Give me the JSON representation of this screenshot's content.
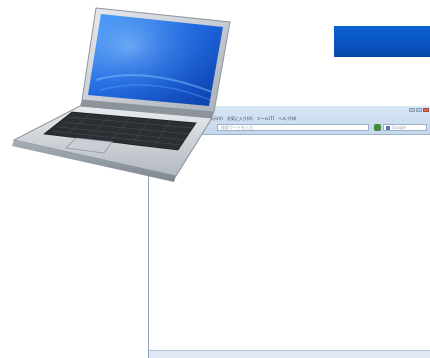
{
  "banner": {
    "color": "#0a5bc8"
  },
  "laptop": {
    "icon": "laptop-icon",
    "screen_color": "#1e5fd8"
  },
  "browser": {
    "menu_items": [
      "表示(V)",
      "お気に入り(A)",
      "ツール(T)",
      "ヘルプ(H)"
    ],
    "address_placeholder": "検索ワードを入力",
    "search_placeholder": "Google"
  }
}
